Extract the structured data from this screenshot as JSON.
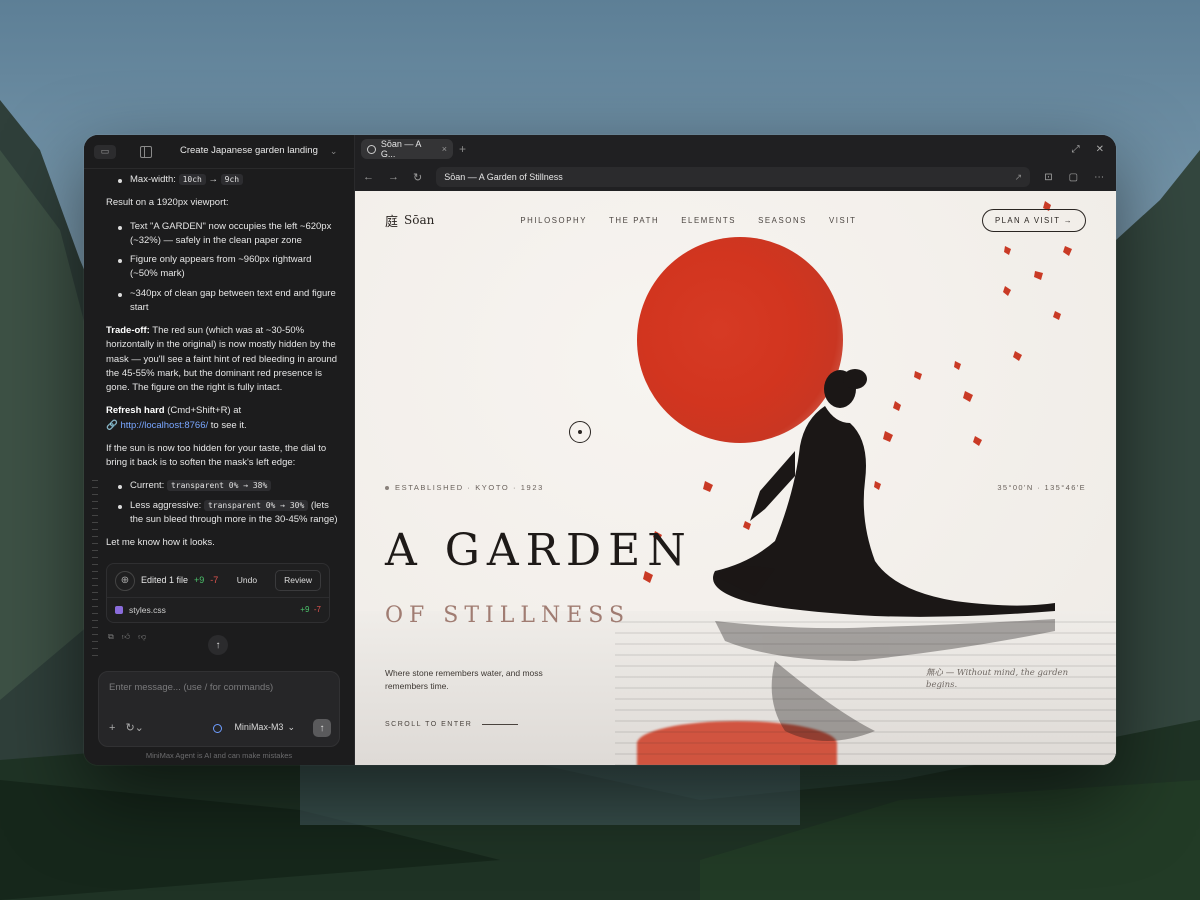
{
  "chat": {
    "header_title": "Create Japanese garden landing",
    "bullet_maxwidth": {
      "label": "Max-width:",
      "from": "10ch",
      "arrow": "→",
      "to": "9ch"
    },
    "result_heading": "Result on a 1920px viewport:",
    "result_items": [
      "Text \"A GARDEN\" now occupies the left ~620px (~32%) — safely in the clean paper zone",
      "Figure only appears from ~960px rightward (~50% mark)",
      "~340px of clean gap between text end and figure start"
    ],
    "tradeoff_label": "Trade-off:",
    "tradeoff_text": " The red sun (which was at ~30-50% horizontally in the original) is now mostly hidden by the mask — you'll see a faint hint of red bleeding in around the 45-55% mark, but the dominant red presence is gone. The figure on the right is fully intact.",
    "refresh_label": "Refresh hard",
    "refresh_text": " (Cmd+Shift+R) at",
    "refresh_link": "http://localhost:8766/",
    "refresh_tail": " to see it.",
    "dial_text": "If the sun is now too hidden for your taste, the dial to bring it back is to soften the mask's left edge:",
    "current_label": "Current:",
    "current_code": "transparent 0% → 38%",
    "aggressive_label": "Less aggressive:",
    "aggressive_code": "transparent 0% → 30%",
    "aggressive_tail": " (lets the sun bleed through more in the 30-45% range)",
    "closing": "Let me know how it looks.",
    "edit_card": {
      "label": "Edited 1 file",
      "plus": "+9",
      "minus": "-7",
      "undo": "Undo",
      "review": "Review",
      "file_name": "styles.css",
      "file_plus": "+9",
      "file_minus": "-7"
    },
    "composer_placeholder": "Enter message... (use / for commands)",
    "model_name": "MiniMax-M3",
    "disclaimer": "MiniMax Agent is AI and can make mistakes"
  },
  "browser": {
    "tab_title": "Sōan — A G...",
    "url": "Sōan — A Garden of Stillness"
  },
  "site": {
    "logo_kanji": "庭",
    "logo_text": "Sōan",
    "nav": [
      "PHILOSOPHY",
      "THE PATH",
      "ELEMENTS",
      "SEASONS",
      "VISIT"
    ],
    "cta": "PLAN A VISIT →",
    "established": "ESTABLISHED · KYOTO · 1923",
    "coords": "35°00'N · 135°46'E",
    "headline": "A GARDEN",
    "subheadline": "OF STILLNESS",
    "description": "Where stone remembers water, and moss remembers time.",
    "scroll_cta": "SCROLL TO ENTER",
    "quote": "無心 — Without mind, the garden begins."
  },
  "colors": {
    "sun": "#d2351f",
    "ink": "#1e1a18",
    "paper": "#f3f0ec",
    "accent_sub": "#a07c72",
    "chat_bg": "#1c1c1d",
    "link": "#79a6ff"
  }
}
